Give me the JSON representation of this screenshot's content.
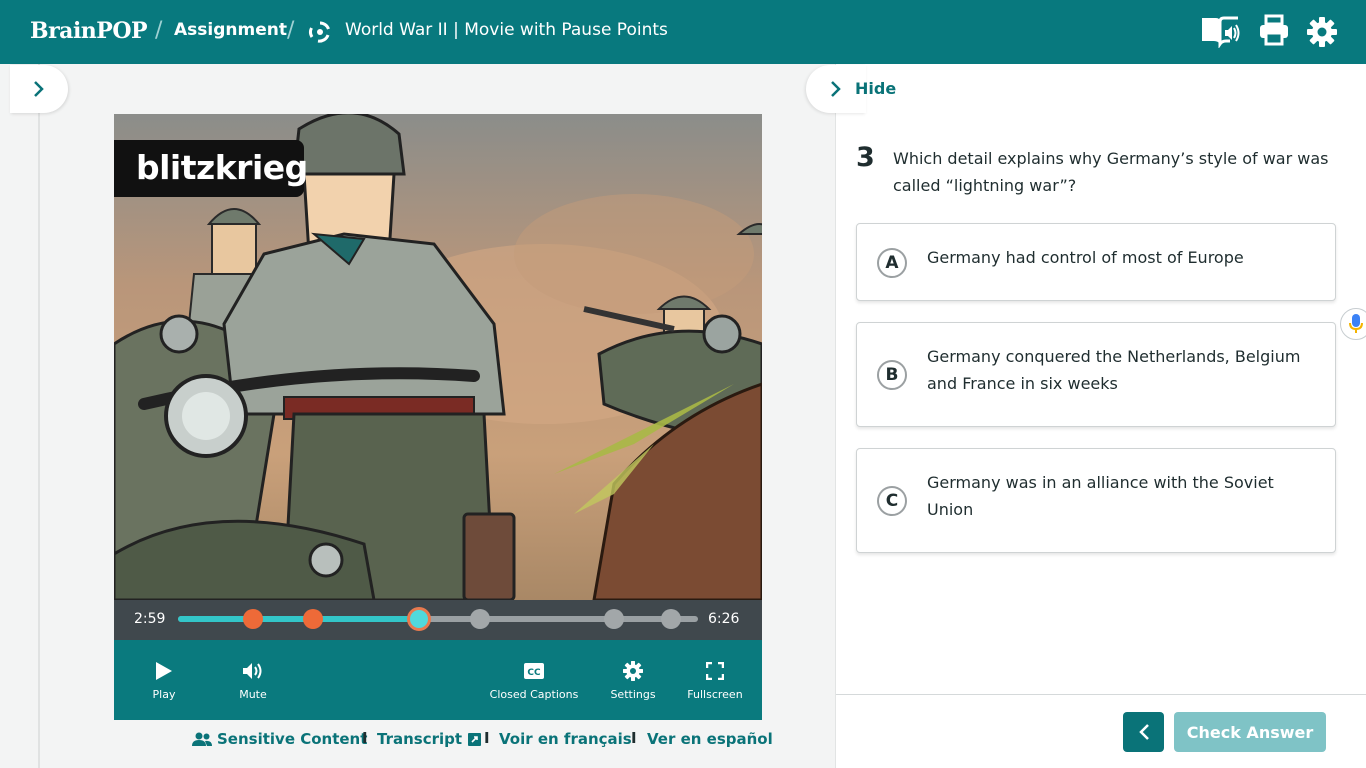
{
  "header": {
    "logo": "BrainPOP",
    "breadcrumb_sep": "/",
    "assignment_label": "Assignment",
    "title": "World War II | Movie with Pause Points",
    "icons": [
      "read-aloud-icon",
      "print-icon",
      "settings-gear-icon"
    ]
  },
  "video": {
    "title_card": "blitzkrieg",
    "current_time": "2:59",
    "total_time": "6:26",
    "progress_fraction": 0.464,
    "pause_points": [
      {
        "position": 0.145,
        "state": "answered"
      },
      {
        "position": 0.26,
        "state": "answered"
      },
      {
        "position": 0.464,
        "state": "current"
      },
      {
        "position": 0.58,
        "state": "upcoming"
      },
      {
        "position": 0.838,
        "state": "upcoming"
      },
      {
        "position": 0.948,
        "state": "upcoming"
      }
    ],
    "controls": {
      "play": "Play",
      "mute": "Mute",
      "captions": "Closed Captions",
      "settings": "Settings",
      "fullscreen": "Fullscreen"
    }
  },
  "links": {
    "sensitive": "Sensitive Content",
    "transcript": "Transcript",
    "french": "Voir en français",
    "spanish": "Ver en español",
    "separator": "I"
  },
  "panel": {
    "hide_label": "Hide",
    "question": {
      "number": "3",
      "text": "Which detail explains why Germany’s style of war was called “lightning war”?",
      "options": [
        {
          "letter": "A",
          "text": "Germany had control of most of Europe"
        },
        {
          "letter": "B",
          "text": "Germany conquered the Netherlands, Belgium and France in six weeks"
        },
        {
          "letter": "C",
          "text": "Germany was in an alliance with the Soviet Union"
        }
      ]
    },
    "check_answer": "Check Answer"
  },
  "colors": {
    "brand_teal": "#08797e",
    "accent_orange": "#ee6a38",
    "progress_cyan": "#33c6c9",
    "check_disabled": "#7fc3c6"
  }
}
